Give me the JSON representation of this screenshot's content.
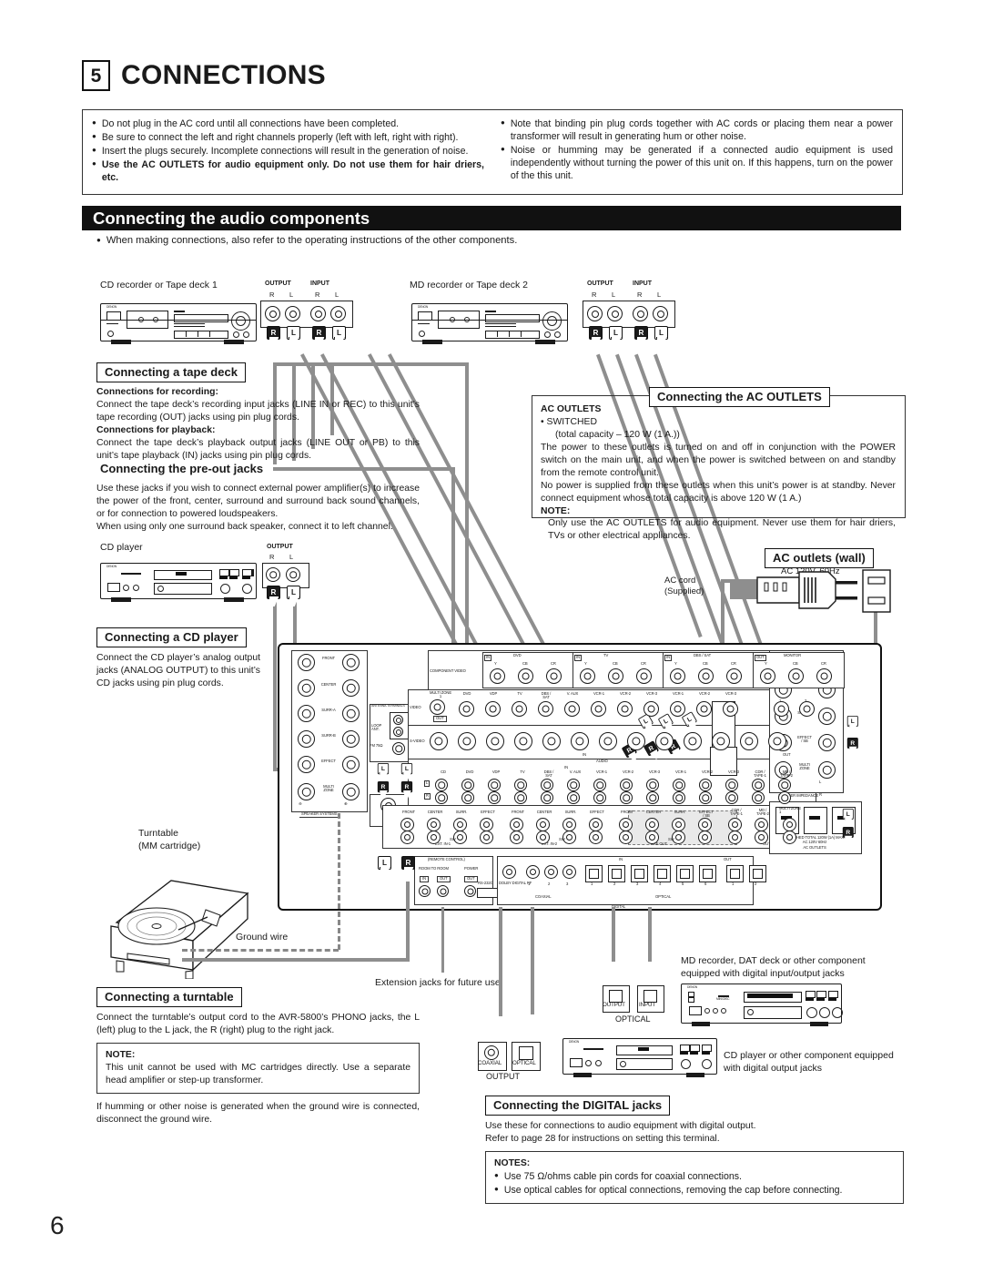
{
  "page": {
    "number": "6"
  },
  "header": {
    "section_number": "5",
    "section_title": "CONNECTIONS",
    "notes_left": [
      {
        "text": "Do not plug in the AC cord until all connections have been completed.",
        "bold": false
      },
      {
        "text": "Be sure to connect the left and right channels properly (left with left, right with right).",
        "bold": false
      },
      {
        "text": "Insert the plugs securely. Incomplete connections will result in the generation of noise.",
        "bold": false
      },
      {
        "text": "Use the AC OUTLETS for audio equipment only. Do not use them for hair driers, etc.",
        "bold": true
      }
    ],
    "notes_right": [
      {
        "text": "Note that binding pin plug cords together with AC cords or placing them near a power transformer will result in generating hum or other noise.",
        "bold": false
      },
      {
        "text": "Noise or humming may be generated if a connected audio equipment is used independently without turning the power of this unit on. If this happens, turn on the power of the this unit.",
        "bold": false
      }
    ],
    "banner_title": "Connecting the audio components",
    "banner_note": "When making connections, also refer to the operating instructions of the other components."
  },
  "boxes": {
    "tape_deck": {
      "caption": "Connecting a tape deck",
      "rec_head": "Connections for recording:",
      "rec_body": "Connect the tape deck’s recording input jacks (LINE IN or REC) to this unit’s tape recording (OUT) jacks using pin plug cords.",
      "pb_head": "Connections for playback:",
      "pb_body": "Connect the tape deck’s playback output jacks (LINE OUT or PB) to this unit’s tape playback (IN) jacks using pin plug cords."
    },
    "pre_out": {
      "caption": "Connecting the pre-out jacks",
      "body": "Use these jacks if you wish to connect external power amplifier(s) to increase the power of the front, center, surround and surround back sound channels, or for connection to powered loudspeakers.\nWhen using only one surround back speaker, connect it to left channel."
    },
    "cd_player": {
      "caption": "Connecting a CD player",
      "body": "Connect the CD player’s analog output jacks (ANALOG OUTPUT) to this unit’s CD jacks using pin plug cords."
    },
    "ac_outlets": {
      "caption": "Connecting the AC OUTLETS",
      "head": "AC OUTLETS",
      "bullet": "SWITCHED",
      "capacity": "(total capacity – 120 W (1 A.))",
      "p1": "The power to these outlets is turned on and off in conjunction with the POWER switch on the main unit, and when the power is switched between on and standby from the remote control unit.",
      "p2": "No power is supplied from these outlets when this unit’s power is at standby. Never connect equipment whose total capacity is above 120 W (1 A.)",
      "note_head": "NOTE:",
      "note_body": "Only use the AC OUTLETS for audio equipment. Never use them for hair driers, TVs or other electrical appliances."
    },
    "turntable": {
      "caption": "Connecting a turntable",
      "body": "Connect the turntable’s output cord to the AVR-5800’s PHONO jacks, the L (left) plug to the L jack, the R (right) plug to the right jack.",
      "note_head": "NOTE:",
      "note_body": "This unit cannot be used with MC cartridges directly. Use a separate head amplifier or step-up transformer.",
      "tail": "If humming or other noise is generated when the ground wire is connected, disconnect the ground wire."
    },
    "digital": {
      "caption": "Connecting the DIGITAL jacks",
      "body1": "Use these for connections to audio equipment with digital output.",
      "body2": "Refer to page 28 for instructions on setting this terminal.",
      "notes_head": "NOTES:",
      "notes": [
        "Use 75 Ω/ohms cable pin cords for coaxial connections.",
        "Use optical cables for optical connections, removing the cap before connecting."
      ]
    }
  },
  "devices": {
    "tape1_label": "CD recorder or Tape deck 1",
    "tape2_label": "MD recorder or Tape deck 2",
    "cd_label": "CD player",
    "turntable_label": "Turntable\n(MM cartridge)",
    "ground_wire": "Ground wire",
    "extension_jacks": "Extension jacks for future use",
    "md_dat_label": "MD recorder, DAT deck or other component equipped with digital input/output jacks",
    "cd_digital_label": "CD player or other component equipped with digital output jacks",
    "ac_wall_caption": "AC outlets (wall)",
    "ac_wall_spec": "AC 120V, 60Hz",
    "ac_cord": "AC cord\n(Supplied)"
  },
  "jack_labels": {
    "output": "OUTPUT",
    "input": "INPUT",
    "r": "R",
    "l": "L",
    "optical": "OPTICAL",
    "coaxial": "COAXIAL"
  },
  "rear_panel": {
    "component_video": {
      "row_label": "COMPONENT VIDEO",
      "groups": [
        {
          "name": "DVD",
          "tag": "IN",
          "pins": [
            "Y",
            "CB",
            "CR"
          ]
        },
        {
          "name": "TV",
          "tag": "IN",
          "pins": [
            "Y",
            "CB",
            "CR"
          ]
        },
        {
          "name": "DBS / SAT",
          "tag": "IN",
          "pins": [
            "Y",
            "CB",
            "CR"
          ]
        },
        {
          "name": "MONITOR",
          "tag": "OUT",
          "pins": [
            "Y",
            "CB",
            "CR"
          ]
        }
      ]
    },
    "video_row": {
      "row_label": "VIDEO",
      "multizone": "MULTI ZONE\n1",
      "multizone_out": "OUT",
      "items": [
        "DVD",
        "VDP",
        "TV",
        "DBS /\nSAT",
        "V. AUX",
        "VCR-1",
        "VCR-2",
        "VCR-3",
        "VCR-1",
        "VCR-2",
        "VCR-3"
      ],
      "monitor": "MONITOR",
      "monitor_pins": [
        "1",
        "2"
      ]
    },
    "svideo_row": {
      "row_label": "S-VIDEO",
      "in": "IN",
      "out": "OUT"
    },
    "audio_row": {
      "row_label": "AUDIO",
      "in": "IN",
      "out": "OUT",
      "items": [
        "CD",
        "DVD",
        "VDP",
        "TV",
        "DBS /\nSAT",
        "V. AUX",
        "VCR-1",
        "VCR-2",
        "VCR-3",
        "VCR-1",
        "VCR-2",
        "VCR-3",
        "CDR /\nTAPE-1",
        "MD /\nTAPE-2"
      ],
      "lr": [
        "L",
        "R"
      ]
    },
    "pre_row": {
      "groups": [
        {
          "label": "EXT. IN-1",
          "items": [
            "FRONT",
            "CENTER",
            "SURR.",
            "EFFECT"
          ]
        },
        {
          "label": "EXT. IN-2",
          "items": [
            "FRONT",
            "CENTER",
            "SURR.",
            "EFFECT"
          ]
        },
        {
          "label": "PRE OUT",
          "items": [
            "FRONT",
            "CENTER",
            "SURR.",
            "EFFECT\n/ SB"
          ]
        }
      ],
      "sw": "SW",
      "rec": [
        "CDR /\nTAPE-1",
        "MD /\nTAPE-2"
      ],
      "multizone": "MULTI ZONE\n1"
    },
    "speakers_left": [
      "FRONT",
      "CENTER",
      "SURR-A",
      "SURR-B",
      "EFFECT",
      "MULTI\nZONE"
    ],
    "speakers_right": [
      "FRONT",
      "SURR-A",
      "SURR-B",
      "EFFECT\n/ SB",
      "MULTI\nZONE"
    ],
    "speaker_systems": "SPEAKER SYSTEMS",
    "speaker_impedance": "SPEAKER IMPEDANCE",
    "antenna": {
      "title": "ANTENNA TERMINALS",
      "loop": "LOOP\nANT.",
      "am": "AM",
      "fm": "FM 75Ω"
    },
    "phono": {
      "label": "PHONO",
      "gnd": "SIGNAL\nGND"
    },
    "remote": {
      "title": "(REMOTE CONTROL)",
      "room": "ROOM TO ROOM",
      "power": "POWER",
      "io": [
        "IN",
        "OUT",
        "OUT"
      ],
      "rs232c": "RS-232C"
    },
    "digital_section": {
      "label": "DIGITAL",
      "in": "IN",
      "out": "OUT",
      "dolby": "DOLBY DIGITAL RF",
      "coaxial": "COAXIAL",
      "optical": "OPTICAL",
      "coax_nums": [
        "1",
        "2",
        "3"
      ],
      "opt_nums": [
        "1",
        "2",
        "3",
        "4",
        "5",
        "6"
      ],
      "out_nums": [
        "1",
        "2"
      ]
    },
    "ac_outlets_plate": "SWITCHED TOTAL 120W (1A) MAX.\nAC 120V 60Hz\nAC OUTLETS"
  }
}
